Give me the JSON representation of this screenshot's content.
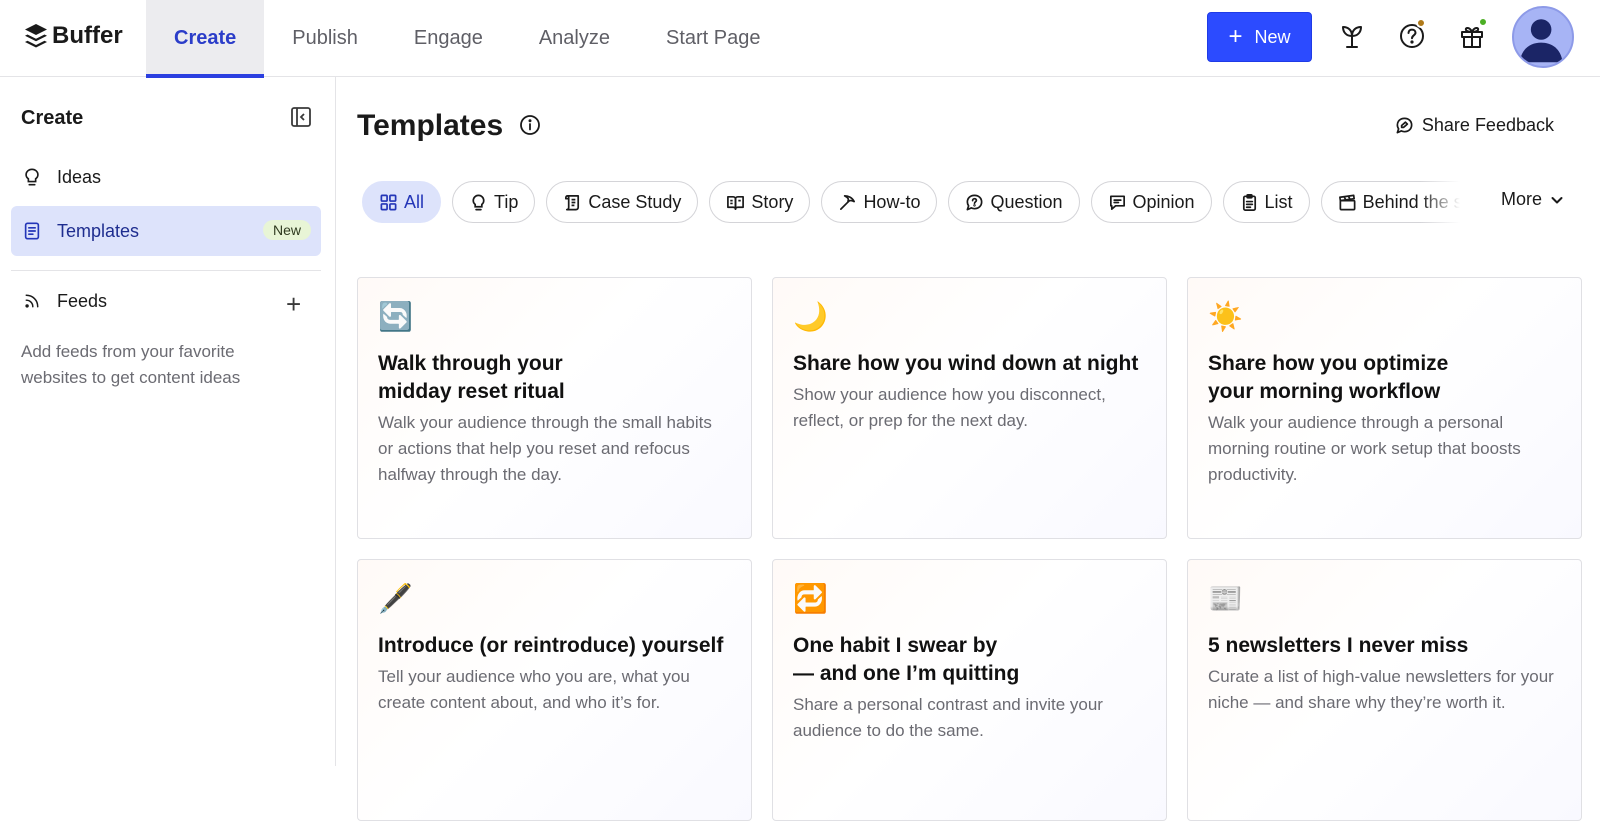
{
  "brand": {
    "name": "Buffer"
  },
  "nav": {
    "tabs": [
      {
        "label": "Create"
      },
      {
        "label": "Publish"
      },
      {
        "label": "Engage"
      },
      {
        "label": "Analyze"
      },
      {
        "label": "Start Page"
      }
    ],
    "active": "Create"
  },
  "header": {
    "new_button": "New",
    "help_dot_color": "#b07a1a",
    "gift_dot_color": "#4caf24",
    "accent": "#2c4bff"
  },
  "sidebar": {
    "title": "Create",
    "items": [
      {
        "label": "Ideas",
        "icon": "lightbulb-icon"
      },
      {
        "label": "Templates",
        "icon": "document-icon",
        "badge": "New"
      }
    ],
    "feeds": {
      "label": "Feeds",
      "help": "Add feeds from your favorite websites to get content ideas"
    }
  },
  "main": {
    "title": "Templates",
    "feedback": "Share Feedback",
    "filters": [
      {
        "label": "All",
        "icon": "grid-icon"
      },
      {
        "label": "Tip",
        "icon": "lightbulb-icon"
      },
      {
        "label": "Case Study",
        "icon": "scroll-icon"
      },
      {
        "label": "Story",
        "icon": "book-icon"
      },
      {
        "label": "How-to",
        "icon": "pickaxe-icon"
      },
      {
        "label": "Question",
        "icon": "question-bubble-icon"
      },
      {
        "label": "Opinion",
        "icon": "speech-bubble-icon"
      },
      {
        "label": "List",
        "icon": "clipboard-icon"
      },
      {
        "label": "Behind the scenes",
        "icon": "clapperboard-icon"
      }
    ],
    "more": "More",
    "cards": [
      {
        "emoji": "🔄",
        "title": "Walk through your\nmidday reset ritual",
        "desc": "Walk your audience through the small habits or actions that help you reset and refocus halfway through the day."
      },
      {
        "emoji": "🌙",
        "title": "Share how you wind down at night",
        "desc": "Show your audience how you disconnect, reflect, or prep for the next day."
      },
      {
        "emoji": "☀️",
        "title": "Share how you optimize\nyour morning workflow",
        "desc": "Walk your audience through a personal morning routine or work setup that boosts productivity."
      },
      {
        "emoji": "🖋️",
        "title": "Introduce (or reintroduce) yourself",
        "desc": "Tell your audience who you are, what you create content about, and who it’s for."
      },
      {
        "emoji": "🔁",
        "title": "One habit I swear by\n— and one I’m quitting",
        "desc": "Share a personal contrast and invite your audience to do the same."
      },
      {
        "emoji": "📰",
        "title": "5 newsletters I never miss",
        "desc": "Curate a list of high-value newsletters for your niche — and share why they’re worth it."
      }
    ]
  }
}
